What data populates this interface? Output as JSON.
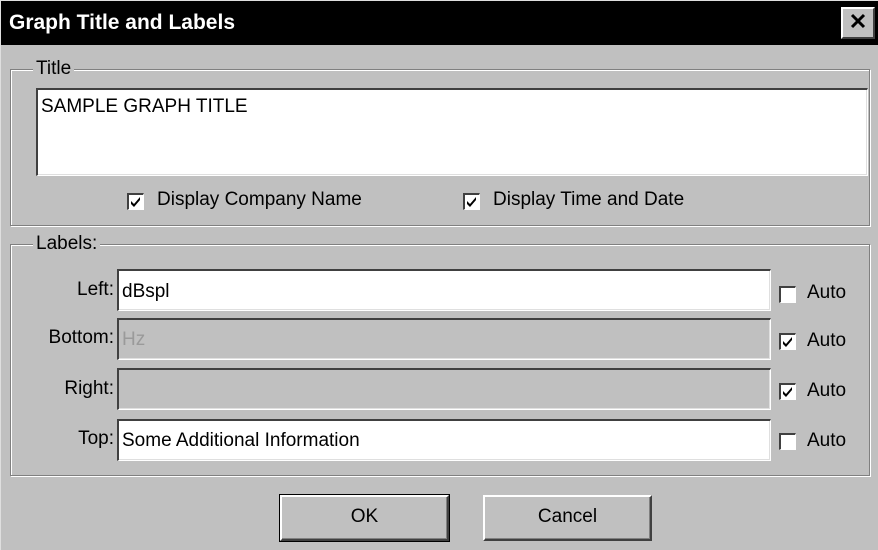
{
  "window": {
    "title": "Graph Title and Labels",
    "close_glyph": "✕"
  },
  "title_group": {
    "legend": "Title",
    "value": "SAMPLE GRAPH TITLE",
    "display_company_name": {
      "label": "Display Company Name",
      "checked": true
    },
    "display_time_date": {
      "label": "Display Time and Date",
      "checked": true
    }
  },
  "labels_group": {
    "legend": "Labels:",
    "rows": [
      {
        "label": "Left:",
        "value": "dBspl",
        "enabled": true,
        "auto_label": "Auto",
        "auto_checked": false
      },
      {
        "label": "Bottom:",
        "value": "Hz",
        "enabled": false,
        "auto_label": "Auto",
        "auto_checked": true
      },
      {
        "label": "Right:",
        "value": "",
        "enabled": false,
        "auto_label": "Auto",
        "auto_checked": true
      },
      {
        "label": "Top:",
        "value": "Some Additional Information",
        "enabled": true,
        "auto_label": "Auto",
        "auto_checked": false
      }
    ]
  },
  "buttons": {
    "ok": "OK",
    "cancel": "Cancel"
  },
  "icons": {
    "close": "close-icon",
    "check": "check-icon"
  }
}
